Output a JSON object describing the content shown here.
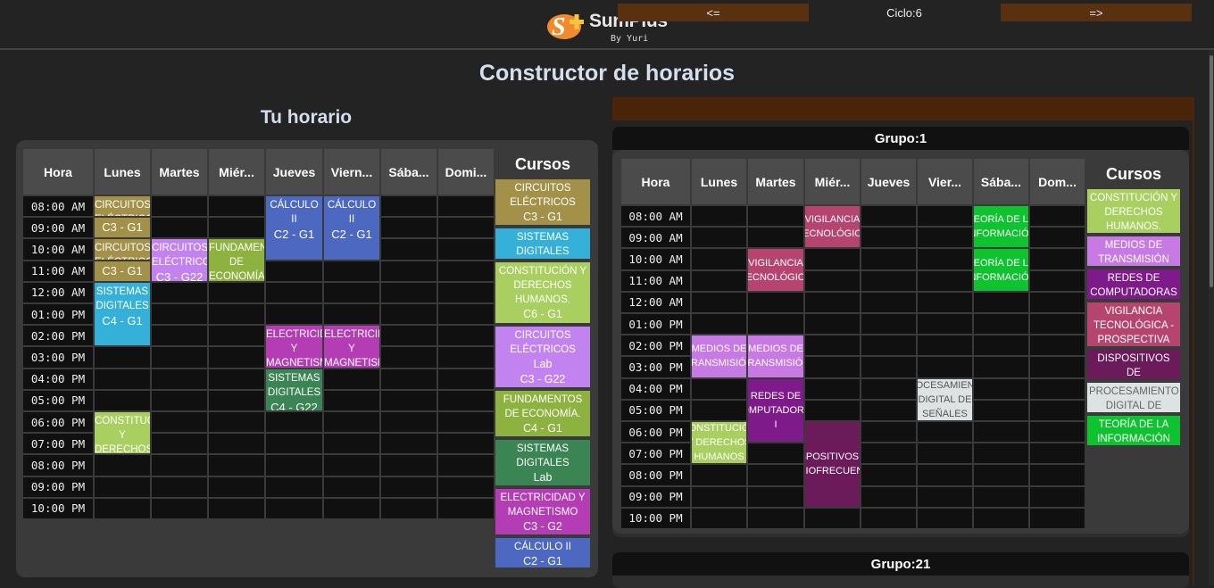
{
  "app": {
    "name": "SumPlus",
    "by": "By Yuri"
  },
  "page_title": "Constructor de horarios",
  "my_schedule": {
    "title": "Tu horario",
    "headers": [
      "Hora",
      "Lunes",
      "Martes",
      "Miér...",
      "Jueves",
      "Viern...",
      "Sába...",
      "Domi..."
    ],
    "times": [
      "08:00 AM",
      "09:00 AM",
      "10:00 AM",
      "11:00 AM",
      "12:00 AM",
      "01:00 PM",
      "02:00 PM",
      "03:00 PM",
      "04:00 PM",
      "05:00 PM",
      "06:00 PM",
      "07:00 PM",
      "08:00 PM",
      "09:00 PM",
      "10:00 PM"
    ],
    "blocks": [
      {
        "day": 1,
        "start": 0,
        "span": 1,
        "name": "CIRCUITOS ELÉCTRICOS",
        "group": "C3 - G1",
        "color": "#a39149"
      },
      {
        "day": 1,
        "start": 1,
        "span": 1,
        "name": "",
        "group": "C3 - G1",
        "color": "#a39149"
      },
      {
        "day": 1,
        "start": 2,
        "span": 1,
        "name": "CIRCUITOS ELÉCTRICOS",
        "group": "",
        "color": "#a39149"
      },
      {
        "day": 1,
        "start": 3,
        "span": 1,
        "name": "",
        "group": "C3 - G1",
        "color": "#a39149"
      },
      {
        "day": 1,
        "start": 4,
        "span": 3,
        "name": "SISTEMAS DIGITALES",
        "group": "C4 - G1",
        "color": "#35b0d8"
      },
      {
        "day": 1,
        "start": 10,
        "span": 2,
        "name": "CONSTITUCIÓN Y DERECHOS",
        "group": "C6 - G1",
        "color": "#a8cf5f"
      },
      {
        "day": 2,
        "start": 2,
        "span": 2,
        "name": "CIRCUITOS ELÉCTRICOS",
        "group": "C3 - G22",
        "color": "#c283f0"
      },
      {
        "day": 3,
        "start": 2,
        "span": 2,
        "name": "FUNDAMENTOS DE ECONOMÍA",
        "group": "C4 - G1",
        "color": "#8eb240"
      },
      {
        "day": 4,
        "start": 0,
        "span": 3,
        "name": "CÁLCULO II",
        "group": "C2 - G1",
        "color": "#4c68c0"
      },
      {
        "day": 4,
        "start": 6,
        "span": 2,
        "name": "ELECTRICIDAD Y MAGNETISMO",
        "group": "C3 - G2",
        "color": "#b43cb5"
      },
      {
        "day": 4,
        "start": 8,
        "span": 2,
        "name": "SISTEMAS DIGITALES",
        "group": "C4 - G22",
        "color": "#3a8553"
      },
      {
        "day": 5,
        "start": 0,
        "span": 3,
        "name": "CÁLCULO II",
        "group": "C2 - G1",
        "color": "#4c68c0"
      },
      {
        "day": 5,
        "start": 6,
        "span": 2,
        "name": "ELECTRICIDAD Y MAGNETISMO",
        "group": "C3 - G2",
        "color": "#b43cb5"
      }
    ],
    "cursos_title": "Cursos",
    "legend": [
      {
        "name": "CIRCUITOS ELÉCTRICOS",
        "lab": "",
        "group": "C3 - G1",
        "color": "#a39149"
      },
      {
        "name": "SISTEMAS DIGITALES",
        "lab": "",
        "group": "C4 - G1",
        "color": "#35b0d8"
      },
      {
        "name": "CONSTITUCIÓN Y DERECHOS HUMANOS.",
        "lab": "",
        "group": "C6 - G1",
        "color": "#a8cf5f"
      },
      {
        "name": "CIRCUITOS ELÉCTRICOS",
        "lab": "Lab",
        "group": "C3 - G22",
        "color": "#c283f0"
      },
      {
        "name": "FUNDAMENTOS DE ECONOMÍA.",
        "lab": "",
        "group": "C4 - G1",
        "color": "#8eb240"
      },
      {
        "name": "SISTEMAS DIGITALES",
        "lab": "Lab",
        "group": "C4 - G22",
        "color": "#3a8553"
      },
      {
        "name": "ELECTRICIDAD Y MAGNETISMO",
        "lab": "",
        "group": "C3 - G2",
        "color": "#b43cb5"
      },
      {
        "name": "CÁLCULO II",
        "lab": "",
        "group": "C2 - G1",
        "color": "#4c68c0"
      }
    ]
  },
  "cycle": {
    "prev": "<=",
    "label": "Ciclo:6",
    "next": "=>"
  },
  "groups": [
    {
      "title": "Grupo:1",
      "headers": [
        "Hora",
        "Lunes",
        "Martes",
        "Miér...",
        "Jueves",
        "Vier...",
        "Sába...",
        "Dom..."
      ],
      "times": [
        "08:00 AM",
        "09:00 AM",
        "10:00 AM",
        "11:00 AM",
        "12:00 AM",
        "01:00 PM",
        "02:00 PM",
        "03:00 PM",
        "04:00 PM",
        "05:00 PM",
        "06:00 PM",
        "07:00 PM",
        "08:00 PM",
        "09:00 PM",
        "10:00 PM"
      ],
      "blocks": [
        {
          "day": 3,
          "start": 0,
          "span": 2,
          "name": "VIGILANCIA TECNOLÓGICA",
          "color": "#b5456f"
        },
        {
          "day": 2,
          "start": 2,
          "span": 2,
          "name": "VIGILANCIA TECNOLÓGICA",
          "color": "#b5456f"
        },
        {
          "day": 6,
          "start": 0,
          "span": 2,
          "name": "TEORÍA DE LA INFORMACIÓN",
          "color": "#0fc230"
        },
        {
          "day": 6,
          "start": 2,
          "span": 2,
          "name": "TEORÍA DE LA INFORMACIÓN",
          "color": "#0fc230"
        },
        {
          "day": 1,
          "start": 6,
          "span": 2,
          "name": "MEDIOS DE TRANSMISIÓN",
          "color": "#c77ae3"
        },
        {
          "day": 2,
          "start": 6,
          "span": 2,
          "name": "MEDIOS DE TRANSMISIÓN",
          "color": "#c77ae3"
        },
        {
          "day": 2,
          "start": 8,
          "span": 3,
          "name": "REDES DE COMPUTADORAS I",
          "color": "#7e1a8a"
        },
        {
          "day": 5,
          "start": 8,
          "span": 2,
          "name": "PROCESAMIENTO DIGITAL DE SEÑALES",
          "color": "#dde3e3",
          "dark": true
        },
        {
          "day": 1,
          "start": 10,
          "span": 2,
          "name": "CONSTITUCIÓN Y DERECHOS HUMANOS",
          "color": "#a8cf5f"
        },
        {
          "day": 3,
          "start": 10,
          "span": 4,
          "name": "DISPOSITIVOS DE RADIOFRECUENCIA",
          "color": "#6b1a5a"
        }
      ],
      "cursos_title": "Cursos",
      "legend": [
        {
          "name": "CONSTITUCIÓN Y DERECHOS HUMANOS.",
          "color": "#a8cf5f"
        },
        {
          "name": "MEDIOS DE TRANSMISIÓN",
          "color": "#c77ae3"
        },
        {
          "name": "REDES DE COMPUTADORAS I",
          "color": "#7e1a8a"
        },
        {
          "name": "VIGILANCIA TECNOLÓGICA - PROSPECTIVA",
          "color": "#b5456f"
        },
        {
          "name": "DISPOSITIVOS DE RADIOFRECUENCIA",
          "color": "#6b1a5a"
        },
        {
          "name": "PROCESAMIENTO DIGITAL DE SEÑALES",
          "color": "#dde3e3",
          "dark": true
        },
        {
          "name": "TEORÍA DE LA INFORMACIÓN",
          "color": "#0fc230"
        }
      ]
    },
    {
      "title": "Grupo:21"
    }
  ]
}
